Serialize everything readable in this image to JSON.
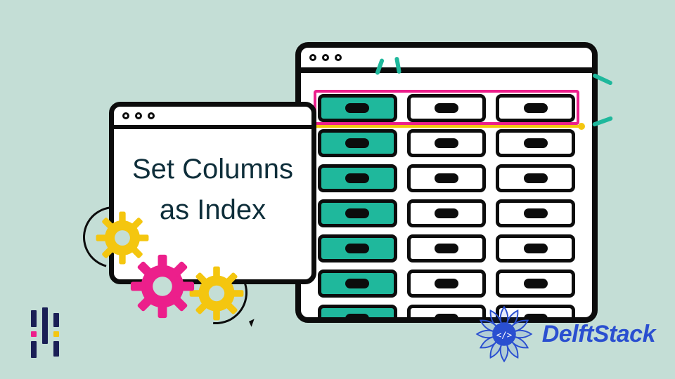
{
  "caption": {
    "line1": "Set Columns",
    "line2": "as Index"
  },
  "table": {
    "rows": 7,
    "cols": 3,
    "index_column": 0,
    "highlighted_row": 0
  },
  "gears": [
    {
      "name": "gear-yellow-top",
      "color": "#f4c60f"
    },
    {
      "name": "gear-pink",
      "color": "#ec1f8b"
    },
    {
      "name": "gear-yellow-bottom",
      "color": "#f4c60f"
    }
  ],
  "logos": {
    "left": "pandas",
    "right_text": "DelftStack",
    "right_badge": "</>"
  },
  "colors": {
    "background": "#c4ded6",
    "stroke": "#0c0c0c",
    "teal": "#1fb89c",
    "pink": "#ec1f8b",
    "yellow": "#f4c60f",
    "blue": "#2a4fd0"
  }
}
